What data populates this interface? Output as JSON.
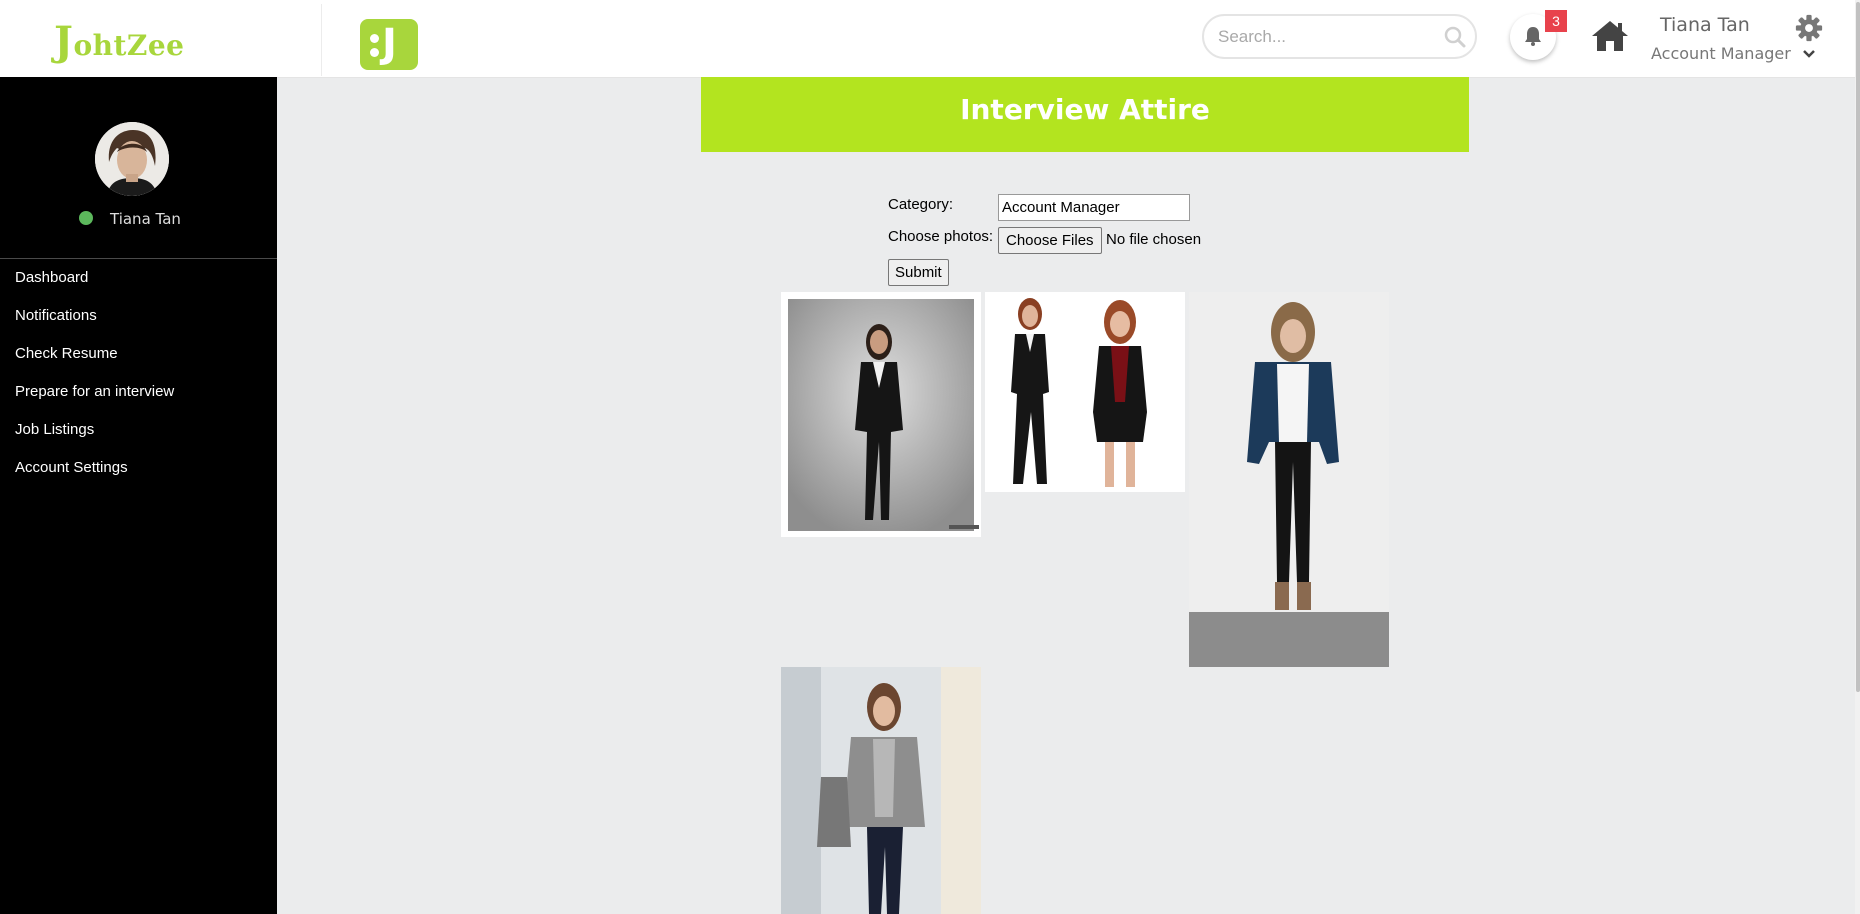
{
  "header": {
    "brand_initial": "J",
    "brand_rest": "ohtZee",
    "logo_letter": "J",
    "search_placeholder": "Search...",
    "notification_count": "3",
    "user_name": "Tiana Tan",
    "user_role": "Account Manager"
  },
  "sidebar": {
    "user_name": "Tiana Tan",
    "items": [
      {
        "label": "Dashboard"
      },
      {
        "label": "Notifications"
      },
      {
        "label": "Check Resume"
      },
      {
        "label": "Prepare for an interview"
      },
      {
        "label": "Job Listings"
      },
      {
        "label": "Account Settings"
      }
    ]
  },
  "main": {
    "title": "Interview Attire",
    "category_label": "Category:",
    "category_value": "Account Manager",
    "photos_label": "Choose photos:",
    "choose_button": "Choose Files",
    "no_file_text": "No file chosen",
    "submit_button": "Submit"
  },
  "icons": [
    "search-icon",
    "bell-icon",
    "home-icon",
    "gear-icon",
    "chevron-down-icon"
  ],
  "colors": {
    "accent": "#b3e41f",
    "brand": "#a8d63c",
    "sidebar_bg": "#000000",
    "badge": "#e8424c",
    "status_online": "#5cb85c"
  }
}
